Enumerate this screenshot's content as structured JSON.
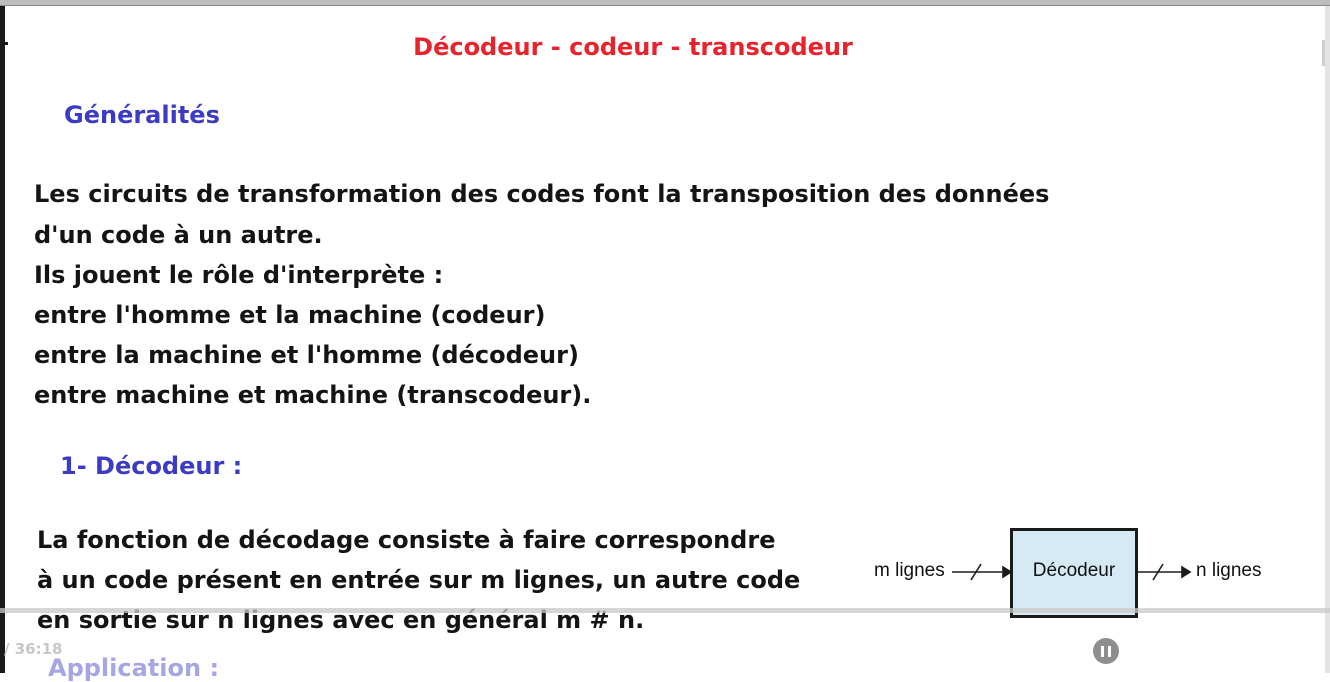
{
  "slide": {
    "title": "Décodeur - codeur - transcodeur",
    "heading_general": "Généralités",
    "intro_lines": [
      "Les circuits de transformation des codes font la transposition des données",
      "d'un code à un autre.",
      "Ils jouent le rôle d'interprète :",
      "entre l'homme et la machine (codeur)",
      "entre la machine et l'homme (décodeur)",
      "entre machine et machine (transcodeur)."
    ],
    "heading_decoder": "1- Décodeur :",
    "decoder_lines": [
      "La fonction de décodage consiste à faire correspondre",
      "à un code présent en entrée sur m lignes, un autre code",
      "en sortie sur n lignes avec en général m # n."
    ],
    "next_heading_partial": "Application :"
  },
  "diagram": {
    "input_label": "m lignes",
    "box_label": "Décodeur",
    "output_label": "n lignes",
    "box_fill": "#d6eaf6"
  },
  "player": {
    "time": "/ 36:18",
    "progress": 0.0,
    "pause_icon": "pause-icon"
  },
  "colors": {
    "title": "#e8232c",
    "heading": "#3b3bc4",
    "body": "#141414"
  }
}
